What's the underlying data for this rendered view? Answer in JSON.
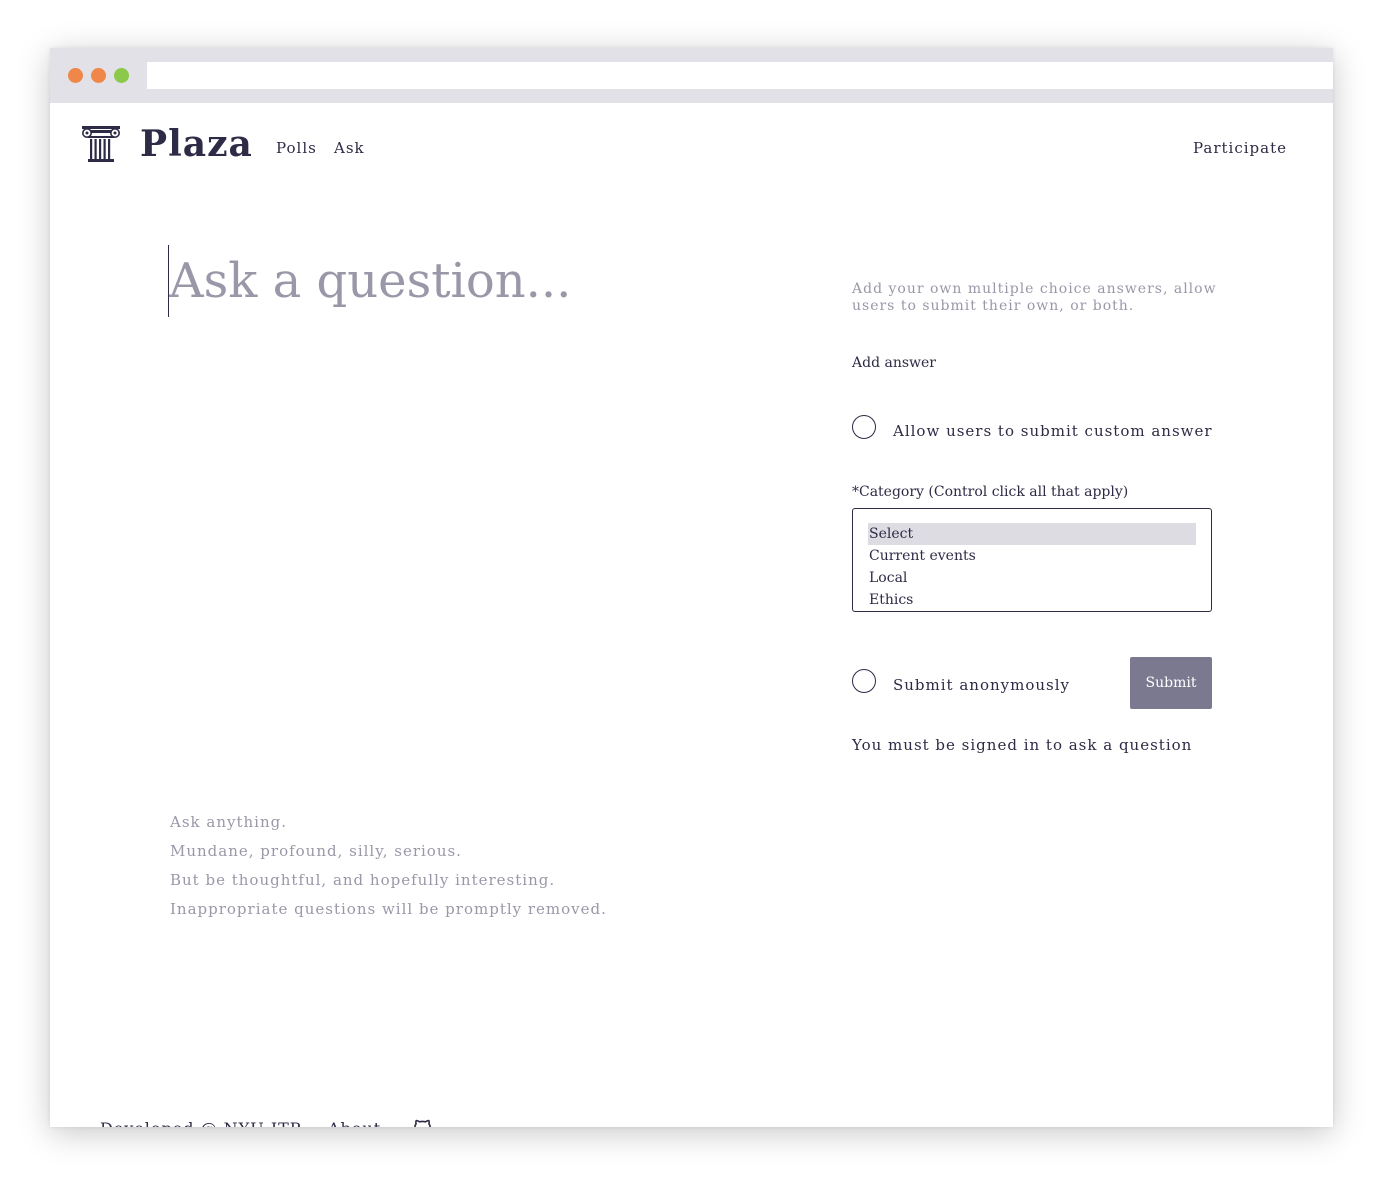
{
  "header": {
    "brand": "Plaza",
    "logo_icon": "column-icon",
    "nav": {
      "polls": "Polls",
      "ask": "Ask",
      "participate": "Participate"
    }
  },
  "question": {
    "placeholder": "Ask a question..."
  },
  "guidelines": [
    "Ask anything.",
    "Mundane, profound, silly, serious.",
    "But be thoughtful, and hopefully interesting.",
    "Inappropriate questions will be promptly removed."
  ],
  "form": {
    "hint": "Add your own multiple choice answers, allow users to submit their own, or both.",
    "add_answer": "Add answer",
    "custom_answer_label": "Allow users to submit custom answer",
    "category_label": "*Category (Control click all that apply)",
    "category_options": [
      "Select",
      "Current events",
      "Local",
      "Ethics"
    ],
    "selected_category": "Select",
    "anonymous_label": "Submit anonymously",
    "submit_label": "Submit",
    "signin_notice": "You must be signed in to ask a question"
  },
  "footer": {
    "developed": "Developed @ NYU ITP",
    "about": "About",
    "github_icon": "github-icon"
  },
  "colors": {
    "text": "#2d2b45",
    "muted": "#9a98a8",
    "button": "#7a7990",
    "selection": "#dddce2"
  }
}
